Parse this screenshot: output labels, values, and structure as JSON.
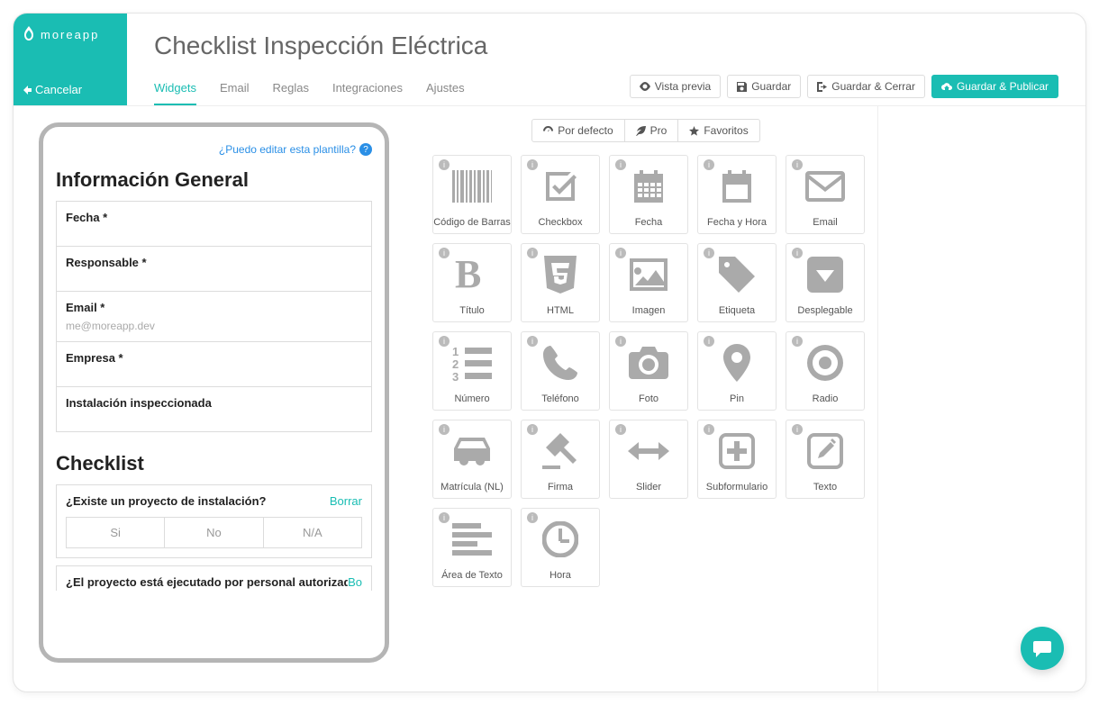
{
  "brand": "moreapp",
  "cancel": "Cancelar",
  "title": "Checklist Inspección Eléctrica",
  "tabs": [
    "Widgets",
    "Email",
    "Reglas",
    "Integraciones",
    "Ajustes"
  ],
  "actions": {
    "preview": "Vista previa",
    "save": "Guardar",
    "save_close": "Guardar & Cerrar",
    "save_publish": "Guardar & Publicar"
  },
  "help_link": "¿Puedo editar esta plantilla?",
  "form": {
    "section1_title": "Información General",
    "fields": [
      {
        "label": "Fecha *"
      },
      {
        "label": "Responsable *"
      },
      {
        "label": "Email *",
        "placeholder": "me@moreapp.dev"
      },
      {
        "label": "Empresa *"
      },
      {
        "label": "Instalación inspeccionada"
      }
    ],
    "section2_title": "Checklist",
    "question1": "¿Existe un proyecto de instalación?",
    "delete": "Borrar",
    "options": [
      "Si",
      "No",
      "N/A"
    ],
    "question2": "¿El proyecto está ejecutado por personal autorizado?",
    "delete2_short": "Bo"
  },
  "palette_tabs": {
    "default": "Por defecto",
    "pro": "Pro",
    "fav": "Favoritos"
  },
  "widgets": [
    "Código de Barras",
    "Checkbox",
    "Fecha",
    "Fecha y Hora",
    "Email",
    "Título",
    "HTML",
    "Imagen",
    "Etiqueta",
    "Desplegable",
    "Número",
    "Teléfono",
    "Foto",
    "Pin",
    "Radio",
    "Matrícula (NL)",
    "Firma",
    "Slider",
    "Subformulario",
    "Texto",
    "Área de Texto",
    "Hora"
  ]
}
